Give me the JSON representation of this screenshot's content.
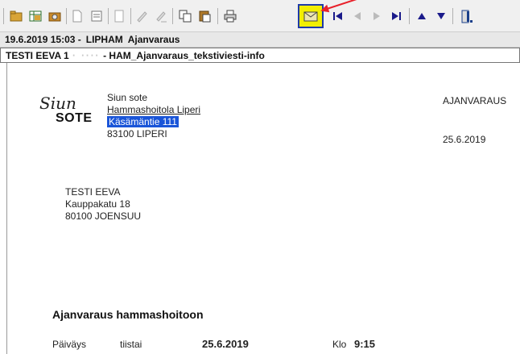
{
  "toolbar": {
    "icons": [
      "open-folder-icon",
      "table-icon",
      "folder-check-icon",
      "new-document-icon",
      "document-list-icon",
      "blank-document-icon",
      "pen-icon",
      "pen-edit-icon",
      "copy-icon",
      "paste-icon",
      "print-icon",
      "envelope-icon",
      "first-page-icon",
      "previous-page-icon",
      "next-page-icon",
      "last-page-icon",
      "up-icon",
      "down-icon",
      "exit-icon"
    ],
    "highlight_color": "#f2ee00",
    "arrow_color": "#e8202a"
  },
  "titlebar": {
    "datetime": "19.6.2019 15:03 -",
    "app": "LIPHAM",
    "module": "Ajanvaraus"
  },
  "docbar": {
    "patient": "TESTI EEVA 1",
    "obscured_id": "‧ ‧‧‧‧",
    "template": "- HAM_Ajanvaraus_tekstiviesti-info"
  },
  "letter": {
    "logo": {
      "script": "Siun",
      "bold": "SOTE"
    },
    "sender": {
      "org": "Siun sote",
      "unit": "Hammashoitola Liperi",
      "street": "Käsämäntie 111",
      "postal": "83100 LIPERI"
    },
    "doc_type": "AJANVARAUS",
    "doc_date": "25.6.2019",
    "recipient": {
      "name": "TESTI EEVA",
      "street": "Kauppakatu 18",
      "postal": "80100 JOENSUU"
    },
    "section_title": "Ajanvaraus hammashoitoon",
    "appointment": {
      "date_label": "Päiväys",
      "weekday": "tiistai",
      "date": "25.6.2019",
      "time_label": "Klo",
      "time": "9:15"
    }
  }
}
